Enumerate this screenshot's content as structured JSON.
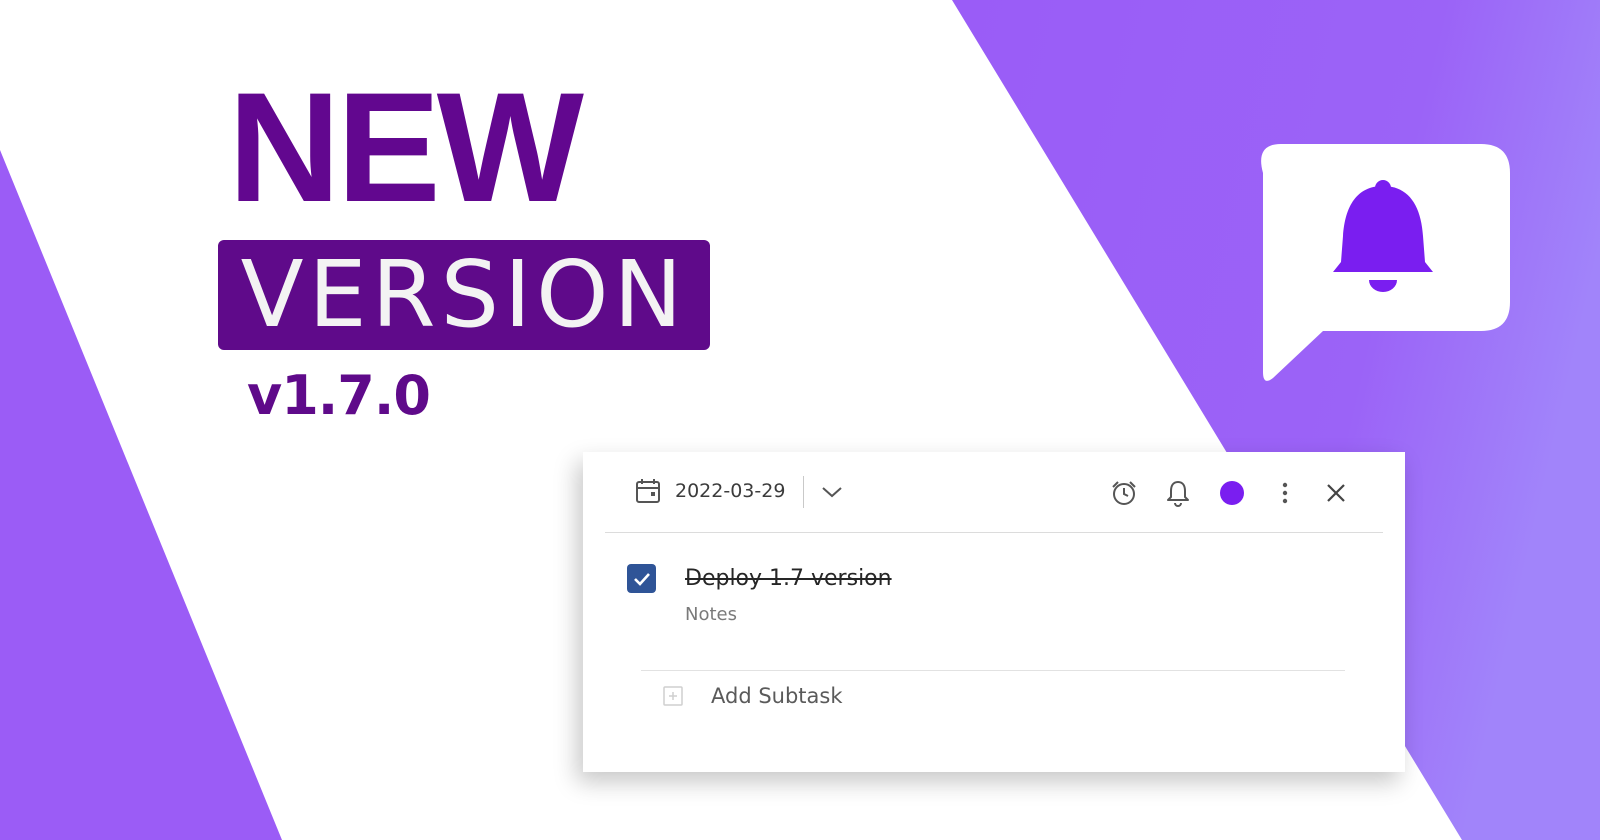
{
  "banner": {
    "headline": "NEW",
    "version_label": "VERSION",
    "version_number": "v1.7.0"
  },
  "task_card": {
    "date": "2022-03-29",
    "task_title": "Deploy 1.7 version",
    "task_completed": true,
    "notes_placeholder": "Notes",
    "add_subtask_label": "Add Subtask",
    "icons": [
      "calendar-icon",
      "chevron-down-icon",
      "alarm-icon",
      "bell-icon",
      "color-dot-icon",
      "more-vertical-icon",
      "close-icon",
      "checkbox-checked-icon",
      "plus-square-icon"
    ]
  },
  "colors": {
    "accent_purple": "#9b5cf6",
    "dark_purple": "#5f0a8a",
    "bell_purple": "#7a1ef0",
    "checkbox_blue": "#2f5497"
  }
}
